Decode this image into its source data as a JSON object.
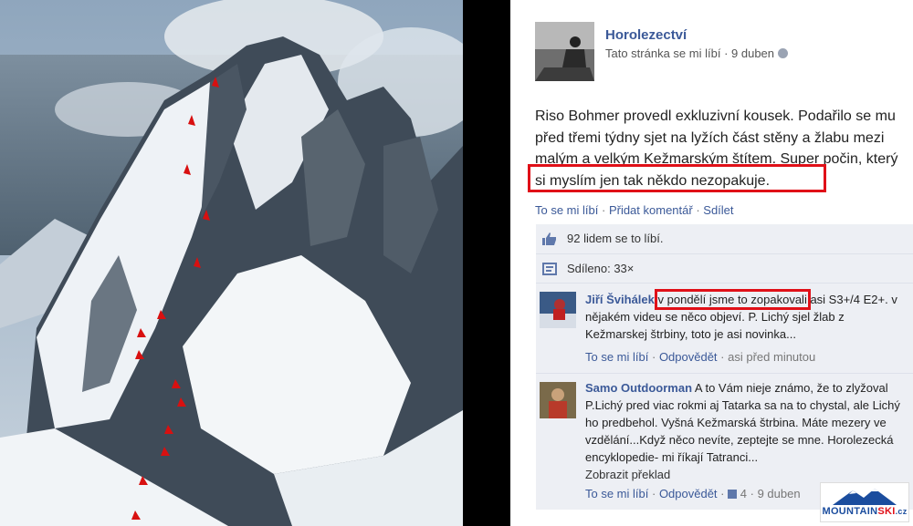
{
  "page": {
    "name": "Horolezectví",
    "meta_likes": "Tato stránka se mi líbí",
    "meta_dot": " · ",
    "meta_date": "9 duben"
  },
  "post": {
    "text_plain": "Riso Bohmer provedl exkluzivní kousek. Podařilo se mu před třemi týdny sjet na lyžích část stěny a žlabu mezi malým a velkým Kežmarským štítem. Super počin,",
    "text_highlight": "který si myslím jen tak někdo nezopakuje.",
    "actions": {
      "like": "To se mi líbí",
      "comment": "Přidat komentář",
      "share": "Sdílet"
    }
  },
  "social": {
    "likes_text": "92 lidem se to líbí.",
    "shares_text": "Sdíleno: 33×"
  },
  "comments": [
    {
      "author": "Jiří Švihálek",
      "text_highlight": "v pondělí jsme to zopakovali",
      "text_rest": " asi S3+/4 E2+. v nějakém videu se něco objeví. P. Lichý sjel žlab z Kežmarskej štrbiny, toto je asi novinka...",
      "like": "To se mi líbí",
      "reply": "Odpovědět",
      "time": "asi před minutou"
    },
    {
      "author": "Samo Outdoorman",
      "text": " A to Vám nieje známo, že to zlyžoval P.Lichý pred viac rokmi aj Tatarka sa na to chystal, ale Lichý ho predbehol. Vyšná Kežmarská štrbina. Máte mezery ve vzdělání...Když něco nevíte, zeptejte se mne. Horolezecká encyklopedie- mi říkají Tatranci...",
      "translate": "Zobrazit překlad",
      "like": "To se mi líbí",
      "reply": "Odpovědět",
      "like_count": "4",
      "time": "9 duben"
    }
  ],
  "logo": {
    "text_main": "MOUNTAIN",
    "text_ski": "SKI",
    "text_tld": ".cz"
  },
  "colors": {
    "link": "#3b5998",
    "highlight": "#e01018",
    "social_bg": "#edeff4"
  }
}
